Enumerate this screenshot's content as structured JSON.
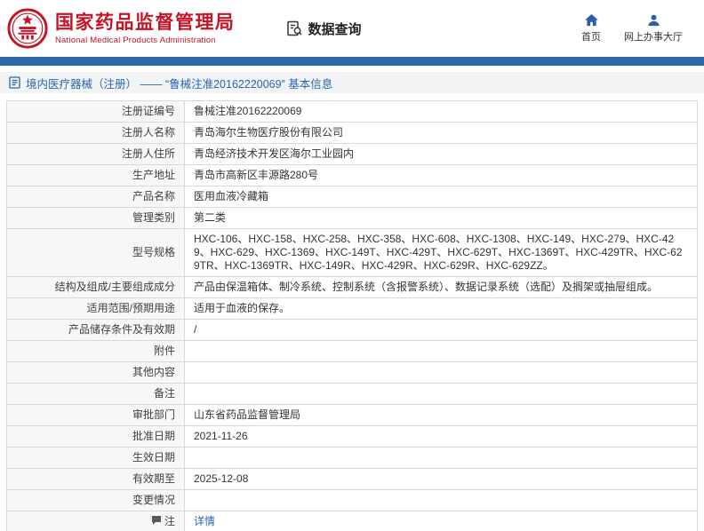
{
  "header": {
    "org_name_cn": "国家药品监督管理局",
    "org_name_en": "National Medical Products Administration",
    "data_query_label": "数据查询",
    "nav_home": "首页",
    "nav_hall": "网上办事大厅"
  },
  "colors": {
    "brand_red": "#c41425",
    "bar_blue": "#2d68a8",
    "link_blue": "#2a65ae",
    "label_bg": "#f7f7f7",
    "border_gray": "#d9d9d9"
  },
  "breadcrumb": {
    "text": "境内医疗器械（注册） ——  “鲁械注准20162220069”  基本信息"
  },
  "table": {
    "rows": [
      {
        "label": "注册证编号",
        "value": "鲁械注准20162220069"
      },
      {
        "label": "注册人名称",
        "value": "青岛海尔生物医疗股份有限公司"
      },
      {
        "label": "注册人住所",
        "value": "青岛经济技术开发区海尔工业园内"
      },
      {
        "label": "生产地址",
        "value": "青岛市高新区丰源路280号"
      },
      {
        "label": "产品名称",
        "value": "医用血液冷藏箱"
      },
      {
        "label": "管理类别",
        "value": "第二类"
      },
      {
        "label": "型号规格",
        "value": "HXC-106、HXC-158、HXC-258、HXC-358、HXC-608、HXC-1308、HXC-149、HXC-279、HXC-429、HXC-629、HXC-1369、HXC-149T、HXC-429T、HXC-629T、HXC-1369T、HXC-429TR、HXC-629TR、HXC-1369TR、HXC-149R、HXC-429R、HXC-629R、HXC-629ZZ。"
      },
      {
        "label": "结构及组成/主要组成成分",
        "value": "产品由保温箱体、制冷系统、控制系统（含报警系统）、数据记录系统（选配）及搁架或抽屉组成。"
      },
      {
        "label": "适用范围/预期用途",
        "value": "适用于血液的保存。"
      },
      {
        "label": "产品储存条件及有效期",
        "value": "/"
      },
      {
        "label": "附件",
        "value": ""
      },
      {
        "label": "其他内容",
        "value": ""
      },
      {
        "label": "备注",
        "value": ""
      },
      {
        "label": "审批部门",
        "value": "山东省药品监督管理局"
      },
      {
        "label": "批准日期",
        "value": "2021-11-26"
      },
      {
        "label": "生效日期",
        "value": ""
      },
      {
        "label": "有效期至",
        "value": "2025-12-08"
      },
      {
        "label": "变更情况",
        "value": ""
      },
      {
        "label": "注",
        "value": "详情"
      }
    ]
  }
}
